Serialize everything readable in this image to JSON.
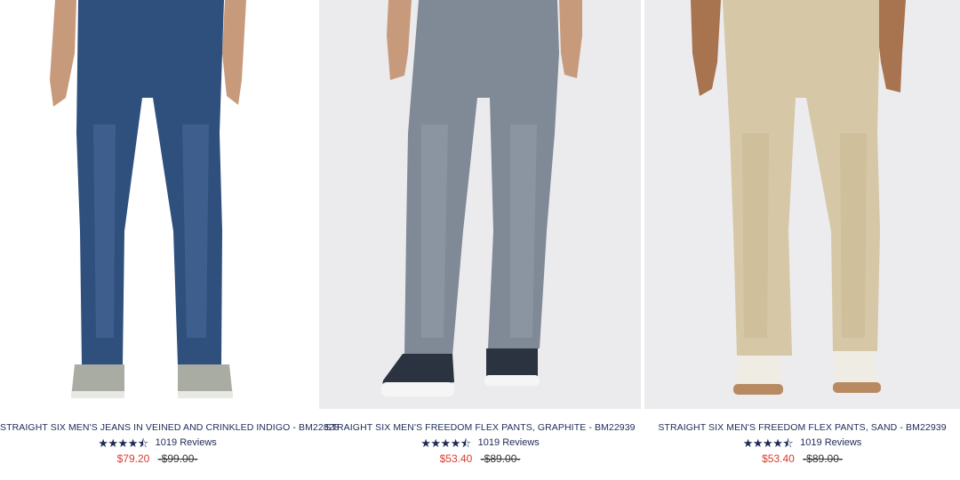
{
  "products": [
    {
      "title": "STRAIGHT SIX MEN'S JEANS IN VEINED AND CRINKLED INDIGO - BM22828",
      "stars": "★★★★⯪",
      "rating_value": 4.5,
      "reviews": "1019 Reviews",
      "sale_price": "$79.20",
      "original_price": "-$99.00-",
      "pant_color": "#2f4f7d",
      "shoe_color": "#a9aca3"
    },
    {
      "title": "STRAIGHT SIX MEN'S FREEDOM FLEX PANTS, GRAPHITE - BM22939",
      "stars": "★★★★⯪",
      "rating_value": 4.5,
      "reviews": "1019 Reviews",
      "sale_price": "$53.40",
      "original_price": "-$89.00-",
      "pant_color": "#7f8a96",
      "shoe_color": "#2b3340"
    },
    {
      "title": "STRAIGHT SIX MEN'S FREEDOM FLEX PANTS, SAND - BM22939",
      "stars": "★★★★⯪",
      "rating_value": 4.5,
      "reviews": "1019 Reviews",
      "sale_price": "$53.40",
      "original_price": "-$89.00-",
      "pant_color": "#d6c7a6",
      "shoe_color": "#efece4"
    }
  ]
}
